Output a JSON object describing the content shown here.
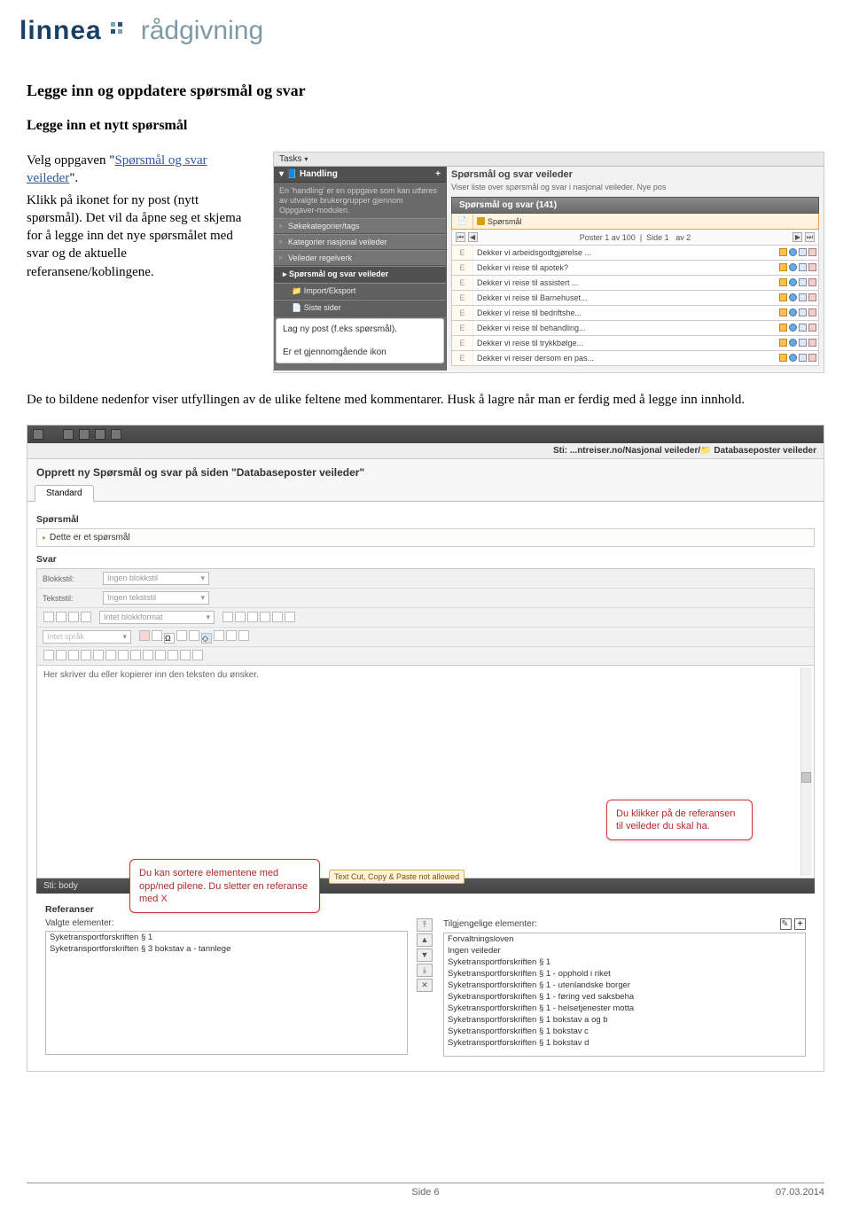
{
  "logo": {
    "main": "linnea",
    "sub": "rådgivning"
  },
  "h1": "Legge inn og oppdatere spørsmål og svar",
  "h2": "Legge inn et nytt spørsmål",
  "intro": {
    "p1a": "Velg oppgaven \"",
    "link": "Spørsmål og svar veileder",
    "p1b": "\".",
    "p2": "Klikk på ikonet for ny post (nytt spørsmål). Det vil da åpne seg et skjema for å legge inn det nye spørsmålet med svar og de aktuelle referansene/koblingene."
  },
  "shot1": {
    "tasks": "Tasks",
    "sidebar": {
      "header": "Handling",
      "desc": "En 'handling' er en oppgave som kan utføres av utvalgte brukergrupper gjennom Oppgaver-modulen.",
      "items": [
        "Søkekategorier/tags",
        "Kategorier nasjonal veileder",
        "Veileder regelverk"
      ],
      "bold": "Spørsmål og svar veileder",
      "sub1": "Import/Eksport",
      "sub2": "Siste sider",
      "callout": "Lag ny post (f.eks spørsmål).\n\nEr et gjennomgående ikon"
    },
    "main": {
      "title": "Spørsmål og svar veileder",
      "sub": "Viser liste over spørsmål og svar i nasjonal veileder. Nye pos",
      "tabhdr": "Spørsmål og svar (141)",
      "rowhdr_label": "Spørsmål",
      "pager_left": "Poster 1 av 100",
      "pager_mid": "Side 1",
      "pager_right": "av 2",
      "rows": [
        "Dekker vi arbeidsgodtgjørelse ...",
        "Dekker vi reise til apotek?",
        "Dekker vi reise til assistert ...",
        "Dekker vi reise til Barnehuset...",
        "Dekker vi reise til bedriftshe...",
        "Dekker vi reise til behandling...",
        "Dekker vi reise til trykkbølge...",
        "Dekker vi reiser dersom en pas..."
      ]
    }
  },
  "body_text": "De to bildene nedenfor viser utfyllingen av de ulike feltene med kommentarer. Husk å lagre når man er ferdig med å legge inn innhold.",
  "shot2": {
    "path_label": "Sti: ",
    "path_value": "...ntreiser.no/Nasjonal veileder/",
    "path_db": "Databaseposter veileder",
    "form_title": "Opprett ny Spørsmål og svar på siden \"Databaseposter veileder\"",
    "tab": "Standard",
    "sporsmal_label": "Spørsmål",
    "sporsmal_value": "Dette er et spørsmål",
    "svar_label": "Svar",
    "blokkstil": "Blokkstil:",
    "blokkstil_ph": "Ingen blokkstil",
    "tekststil": "Tekststil:",
    "tekststil_ph": "Ingen tekststil",
    "blokkformat": "Intet blokkformat",
    "intet_sprak": "Intet språk",
    "textarea": "Her skriver du eller kopierer inn den teksten du ønsker.",
    "sti_body": "Sti:   body",
    "ref_label": "Referanser",
    "valgte": "Valgte elementer:",
    "tilgjengelige": "Tilgjengelige elementer:",
    "selected": [
      "Syketransportforskriften § 1",
      "Syketransportforskriften § 3 bokstav a - tannlege"
    ],
    "available": [
      "Forvaltningsloven",
      "Ingen veileder",
      "Syketransportforskriften § 1",
      "Syketransportforskriften § 1 - opphold i riket",
      "Syketransportforskriften § 1 - utenlandske borger",
      "Syketransportforskriften § 1 - føring ved saksbeha",
      "Syketransportforskriften § 1 - helsetjenester motta",
      "Syketransportforskriften § 1 bokstav a og b",
      "Syketransportforskriften § 1 bokstav c",
      "Syketransportforskriften § 1 bokstav d"
    ],
    "callout1": "Du kan sortere elementene med opp/ned pilene. Du sletter en referanse med X",
    "callout2": "Du klikker på de referansen til veileder du skal ha.",
    "warn": "Text Cut, Copy & Paste not allowed"
  },
  "footer": {
    "page": "Side 6",
    "date": "07.03.2014"
  }
}
